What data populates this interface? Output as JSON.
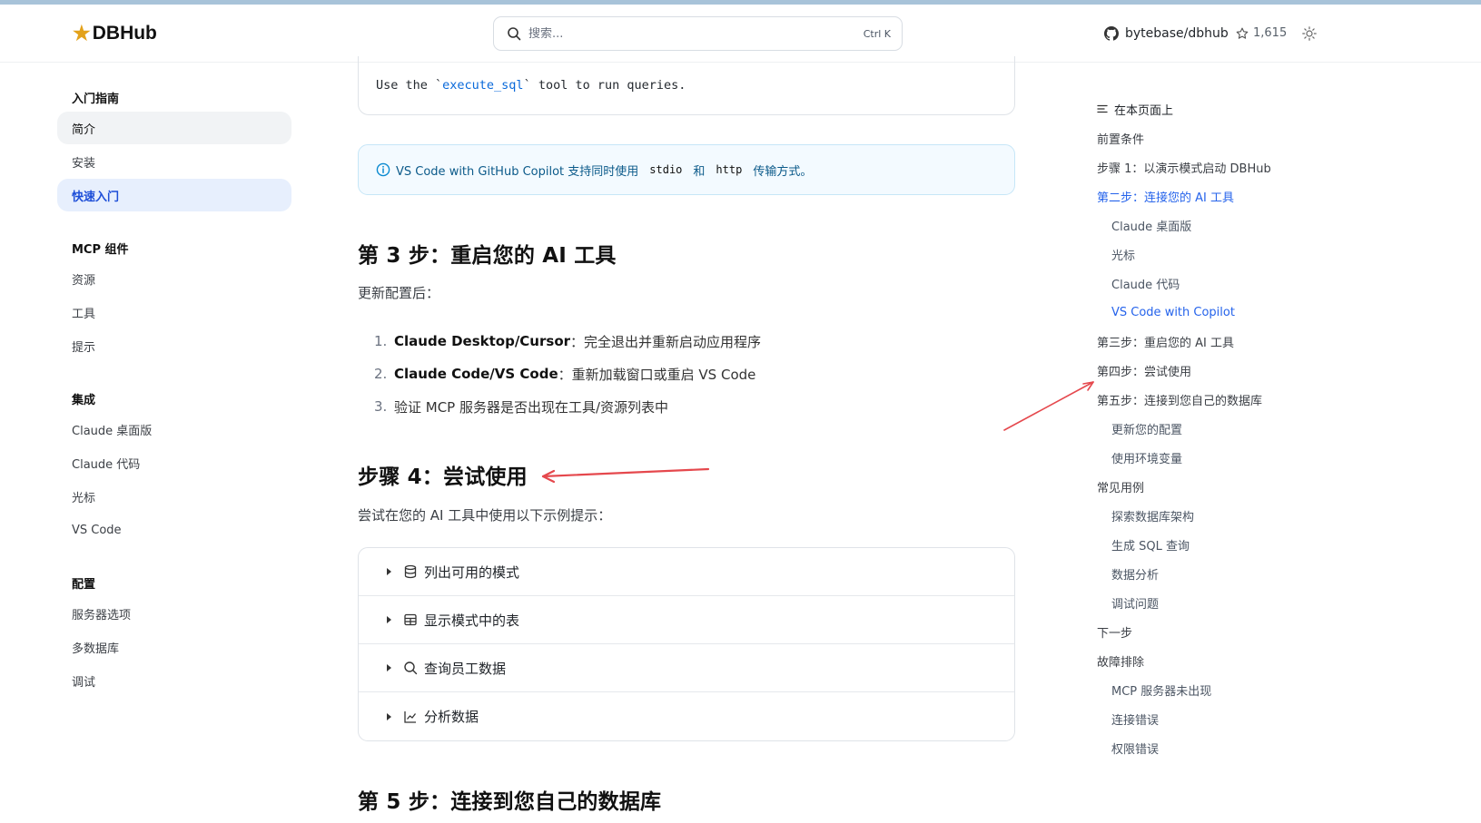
{
  "header": {
    "logo_text": "DBHub",
    "search_placeholder": "搜索...",
    "search_shortcut": "Ctrl K",
    "repo": "bytebase/dbhub",
    "stars": "1,615"
  },
  "sidebar": {
    "sections": [
      {
        "title": "入门指南",
        "items": [
          "简介",
          "安装",
          "快速入门"
        ]
      },
      {
        "title": "MCP 组件",
        "items": [
          "资源",
          "工具",
          "提示"
        ]
      },
      {
        "title": "集成",
        "items": [
          "Claude 桌面版",
          "Claude 代码",
          "光标",
          "VS Code"
        ]
      },
      {
        "title": "配置",
        "items": [
          "服务器选项",
          "多数据库",
          "调试"
        ]
      }
    ]
  },
  "main": {
    "code": {
      "prefix": "Use the `",
      "fn": "execute_sql",
      "suffix": "` tool to run queries."
    },
    "callout": {
      "text1": "VS Code with GitHub Copilot 支持同时使用",
      "code1": "stdio",
      "text2": "和",
      "code2": "http",
      "text3": "传输方式。"
    },
    "step3_heading": "第 3 步：重启您的 AI 工具",
    "step3_intro": "更新配置后：",
    "step3_list": [
      {
        "num": "1.",
        "bold": "Claude Desktop/Cursor",
        "text": "：完全退出并重新启动应用程序"
      },
      {
        "num": "2.",
        "bold": "Claude Code/VS Code",
        "text": "：重新加载窗口或重启 VS Code"
      },
      {
        "num": "3.",
        "bold": "",
        "text": "验证 MCP 服务器是否出现在工具/资源列表中"
      }
    ],
    "step4_heading": "步骤 4：尝试使用",
    "step4_intro": "尝试在您的 AI 工具中使用以下示例提示：",
    "examples": [
      "列出可用的模式",
      "显示模式中的表",
      "查询员工数据",
      "分析数据"
    ],
    "step5_heading": "第 5 步：连接到您自己的数据库"
  },
  "toc": {
    "title": "在本页面上",
    "items": [
      {
        "label": "前置条件",
        "level": 1
      },
      {
        "label": "步骤 1：以演示模式启动 DBHub",
        "level": 1
      },
      {
        "label": "第二步：连接您的 AI 工具",
        "level": 1
      },
      {
        "label": "Claude 桌面版",
        "level": 2
      },
      {
        "label": "光标",
        "level": 2
      },
      {
        "label": "Claude 代码",
        "level": 2
      },
      {
        "label": "VS Code with Copilot",
        "level": 2
      },
      {
        "label": "第三步：重启您的 AI 工具",
        "level": 1
      },
      {
        "label": "第四步：尝试使用",
        "level": 1
      },
      {
        "label": "第五步：连接到您自己的数据库",
        "level": 1
      },
      {
        "label": "更新您的配置",
        "level": 2
      },
      {
        "label": "使用环境变量",
        "level": 2
      },
      {
        "label": "常见用例",
        "level": 1
      },
      {
        "label": "探索数据库架构",
        "level": 2
      },
      {
        "label": "生成 SQL 查询",
        "level": 2
      },
      {
        "label": "数据分析",
        "level": 2
      },
      {
        "label": "调试问题",
        "level": 2
      },
      {
        "label": "下一步",
        "level": 1
      },
      {
        "label": "故障排除",
        "level": 1
      },
      {
        "label": "MCP 服务器未出现",
        "level": 2
      },
      {
        "label": "连接错误",
        "level": 2
      },
      {
        "label": "权限错误",
        "level": 2
      }
    ]
  },
  "colors": {
    "accent": "#2563eb",
    "annotation_arrow": "#e5484d"
  }
}
